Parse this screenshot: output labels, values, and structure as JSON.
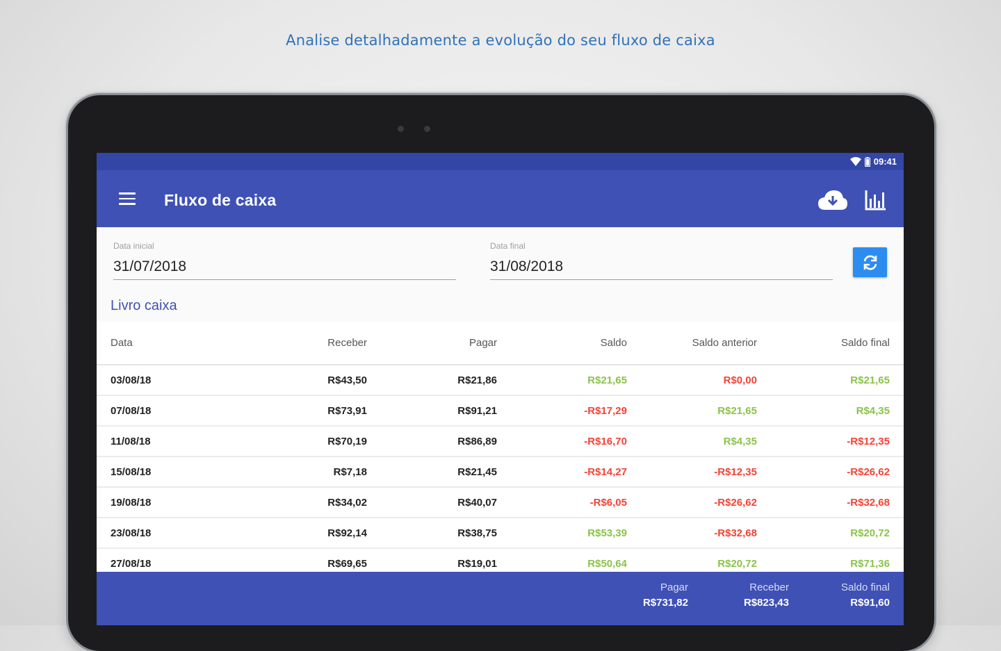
{
  "headline": "Analise detalhadamente a evolução do seu fluxo de caixa",
  "status_bar": {
    "time": "09:41",
    "icons": [
      "wifi-icon",
      "battery-icon"
    ]
  },
  "app_bar": {
    "title": "Fluxo de caixa",
    "icons": [
      "menu-icon",
      "cloud-download-icon",
      "bar-chart-icon"
    ],
    "color": "#3f51b5"
  },
  "filters": {
    "start_label": "Data inicial",
    "start_value": "31/07/2018",
    "end_label": "Data final",
    "end_value": "31/08/2018",
    "refresh_icon": "refresh-icon",
    "refresh_color": "#2d8cf0"
  },
  "section_title": "Livro caixa",
  "table": {
    "headers": [
      "Data",
      "Receber",
      "Pagar",
      "Saldo",
      "Saldo anterior",
      "Saldo final"
    ],
    "rows": [
      {
        "date": "03/08/18",
        "receber": "R$43,50",
        "pagar": "R$21,86",
        "saldo": "R$21,65",
        "saldo_anterior": "R$0,00",
        "saldo_final": "R$21,65"
      },
      {
        "date": "07/08/18",
        "receber": "R$73,91",
        "pagar": "R$91,21",
        "saldo": "-R$17,29",
        "saldo_anterior": "R$21,65",
        "saldo_final": "R$4,35"
      },
      {
        "date": "11/08/18",
        "receber": "R$70,19",
        "pagar": "R$86,89",
        "saldo": "-R$16,70",
        "saldo_anterior": "R$4,35",
        "saldo_final": "-R$12,35"
      },
      {
        "date": "15/08/18",
        "receber": "R$7,18",
        "pagar": "R$21,45",
        "saldo": "-R$14,27",
        "saldo_anterior": "-R$12,35",
        "saldo_final": "-R$26,62"
      },
      {
        "date": "19/08/18",
        "receber": "R$34,02",
        "pagar": "R$40,07",
        "saldo": "-R$6,05",
        "saldo_anterior": "-R$26,62",
        "saldo_final": "-R$32,68"
      },
      {
        "date": "23/08/18",
        "receber": "R$92,14",
        "pagar": "R$38,75",
        "saldo": "R$53,39",
        "saldo_anterior": "-R$32,68",
        "saldo_final": "R$20,72"
      },
      {
        "date": "27/08/18",
        "receber": "R$69,65",
        "pagar": "R$19,01",
        "saldo": "R$50,64",
        "saldo_anterior": "R$20,72",
        "saldo_final": "R$71,36"
      }
    ],
    "positive_color": "#8bc34a",
    "negative_color": "#f44336"
  },
  "footer": {
    "pagar_label": "Pagar",
    "pagar_value": "R$731,82",
    "receber_label": "Receber",
    "receber_value": "R$823,43",
    "saldo_label": "Saldo final",
    "saldo_value": "R$91,60"
  }
}
